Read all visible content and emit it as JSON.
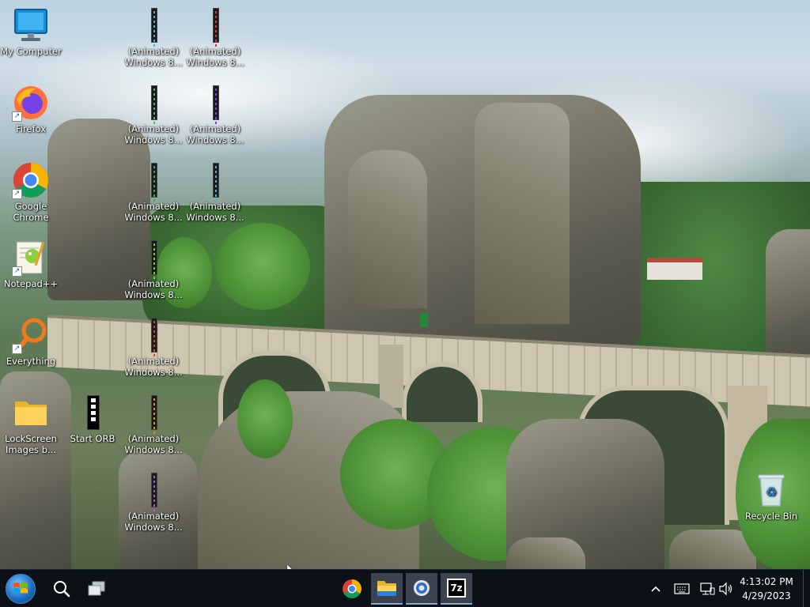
{
  "desktop_icons": [
    {
      "id": "my-computer",
      "label": "My Computer",
      "icon": "monitor-icon"
    },
    {
      "id": "firefox",
      "label": "Firefox",
      "icon": "firefox-icon"
    },
    {
      "id": "google-chrome",
      "label": "Google\nChrome",
      "icon": "chrome-icon"
    },
    {
      "id": "notepad-plus-plus",
      "label": "Notepad++",
      "icon": "notepad-plus-plus-icon"
    },
    {
      "id": "everything",
      "label": "Everything",
      "icon": "everything-search-icon"
    },
    {
      "id": "lockscreen-images",
      "label": "LockScreen\nImages b...",
      "icon": "folder-icon"
    },
    {
      "id": "start-orb",
      "label": "Start ORB",
      "icon": "start-orb-strip-icon"
    },
    {
      "id": "animated-1",
      "label": "(Animated)\nWindows 8...",
      "icon": "animated-strip-icon"
    },
    {
      "id": "animated-2",
      "label": "(Animated)\nWindows 8...",
      "icon": "animated-strip-icon"
    },
    {
      "id": "animated-3",
      "label": "(Animated)\nWindows 8...",
      "icon": "animated-strip-icon"
    },
    {
      "id": "animated-4",
      "label": "(Animated)\nWindows 8...",
      "icon": "animated-strip-icon"
    },
    {
      "id": "animated-5",
      "label": "(Animated)\nWindows 8...",
      "icon": "animated-strip-icon"
    },
    {
      "id": "animated-6",
      "label": "(Animated)\nWindows 8...",
      "icon": "animated-strip-icon"
    },
    {
      "id": "animated-7",
      "label": "(Animated)\nWindows 8...",
      "icon": "animated-strip-icon"
    },
    {
      "id": "animated-8",
      "label": "(Animated)\nWindows 8...",
      "icon": "animated-strip-icon"
    },
    {
      "id": "animated-9",
      "label": "(Animated)\nWindows 8...",
      "icon": "animated-strip-icon"
    },
    {
      "id": "animated-10",
      "label": "(Animated)\nWindows 8...",
      "icon": "animated-strip-icon"
    },
    {
      "id": "recycle-bin",
      "label": "Recycle Bin",
      "icon": "recycle-bin-icon"
    }
  ],
  "taskbar": {
    "start_icon": "windows-start-orb-icon",
    "search_icon": "search-icon",
    "task_view_icon": "task-view-icon",
    "pinned": [
      {
        "name": "Google Chrome",
        "icon": "chrome-icon",
        "active": false
      },
      {
        "name": "File Explorer",
        "icon": "file-explorer-icon",
        "active": true
      },
      {
        "name": "Settings",
        "icon": "gear-icon",
        "active": true
      },
      {
        "name": "7-Zip",
        "icon": "7zip-icon",
        "active": true
      }
    ],
    "tray": {
      "overflow_icon": "chevron-up-icon",
      "keyboard_icon": "keyboard-icon",
      "network_icon": "network-icon",
      "volume_icon": "volume-icon"
    },
    "clock": {
      "time": "4:13:02 PM",
      "date": "4/29/2023"
    }
  },
  "colors": {
    "taskbar_bg": "#0c1118",
    "active_task_bg": "#3b4350",
    "icon_label": "#ffffff"
  }
}
